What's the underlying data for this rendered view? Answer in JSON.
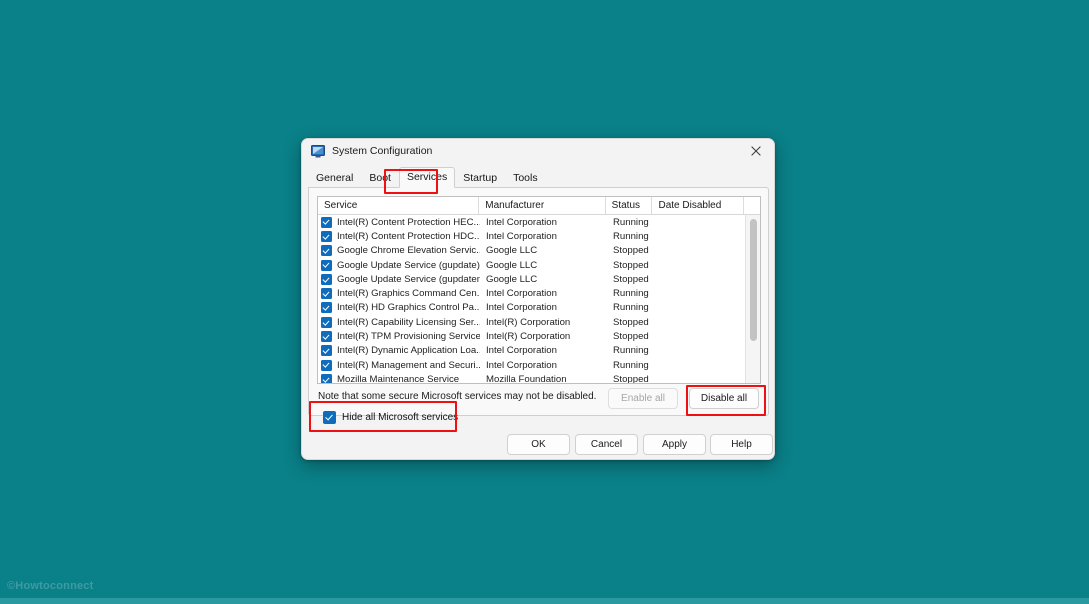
{
  "desktop": {
    "background_color": "#0a8088",
    "watermark": "©Howtoconnect"
  },
  "dialog": {
    "title": "System Configuration",
    "title_icon": "system-configuration-icon",
    "close_icon": "close-icon",
    "tabs": [
      {
        "label": "General",
        "selected": false
      },
      {
        "label": "Boot",
        "selected": false
      },
      {
        "label": "Services",
        "selected": true
      },
      {
        "label": "Startup",
        "selected": false
      },
      {
        "label": "Tools",
        "selected": false
      }
    ],
    "services_table": {
      "columns": [
        "Service",
        "Manufacturer",
        "Status",
        "Date Disabled"
      ],
      "rows": [
        {
          "checked": true,
          "service": "Intel(R) Content Protection HEC...",
          "manufacturer": "Intel Corporation",
          "status": "Running",
          "date_disabled": ""
        },
        {
          "checked": true,
          "service": "Intel(R) Content Protection HDC...",
          "manufacturer": "Intel Corporation",
          "status": "Running",
          "date_disabled": ""
        },
        {
          "checked": true,
          "service": "Google Chrome Elevation Servic...",
          "manufacturer": "Google LLC",
          "status": "Stopped",
          "date_disabled": ""
        },
        {
          "checked": true,
          "service": "Google Update Service (gupdate)",
          "manufacturer": "Google LLC",
          "status": "Stopped",
          "date_disabled": ""
        },
        {
          "checked": true,
          "service": "Google Update Service (gupdatem)",
          "manufacturer": "Google LLC",
          "status": "Stopped",
          "date_disabled": ""
        },
        {
          "checked": true,
          "service": "Intel(R) Graphics Command Cen...",
          "manufacturer": "Intel Corporation",
          "status": "Running",
          "date_disabled": ""
        },
        {
          "checked": true,
          "service": "Intel(R) HD Graphics Control Pa...",
          "manufacturer": "Intel Corporation",
          "status": "Running",
          "date_disabled": ""
        },
        {
          "checked": true,
          "service": "Intel(R) Capability Licensing Ser...",
          "manufacturer": "Intel(R) Corporation",
          "status": "Stopped",
          "date_disabled": ""
        },
        {
          "checked": true,
          "service": "Intel(R) TPM Provisioning Service",
          "manufacturer": "Intel(R) Corporation",
          "status": "Stopped",
          "date_disabled": ""
        },
        {
          "checked": true,
          "service": "Intel(R) Dynamic Application Loa...",
          "manufacturer": "Intel Corporation",
          "status": "Running",
          "date_disabled": ""
        },
        {
          "checked": true,
          "service": "Intel(R) Management and Securi...",
          "manufacturer": "Intel Corporation",
          "status": "Running",
          "date_disabled": ""
        },
        {
          "checked": true,
          "service": "Mozilla Maintenance Service",
          "manufacturer": "Mozilla Foundation",
          "status": "Stopped",
          "date_disabled": ""
        }
      ]
    },
    "note": "Note that some secure Microsoft services may not be disabled.",
    "hide_microsoft_services": {
      "label": "Hide all Microsoft services",
      "checked": true
    },
    "enable_all_button": {
      "label": "Enable all",
      "enabled": false
    },
    "disable_all_button": {
      "label": "Disable all",
      "enabled": true
    },
    "footer_buttons": [
      {
        "label": "OK"
      },
      {
        "label": "Cancel"
      },
      {
        "label": "Apply"
      },
      {
        "label": "Help"
      }
    ]
  },
  "annotations": {
    "highlight_color": "#ee1111",
    "boxes": [
      "services-tab",
      "disable-all-button",
      "hide-all-microsoft-services-checkbox"
    ]
  }
}
